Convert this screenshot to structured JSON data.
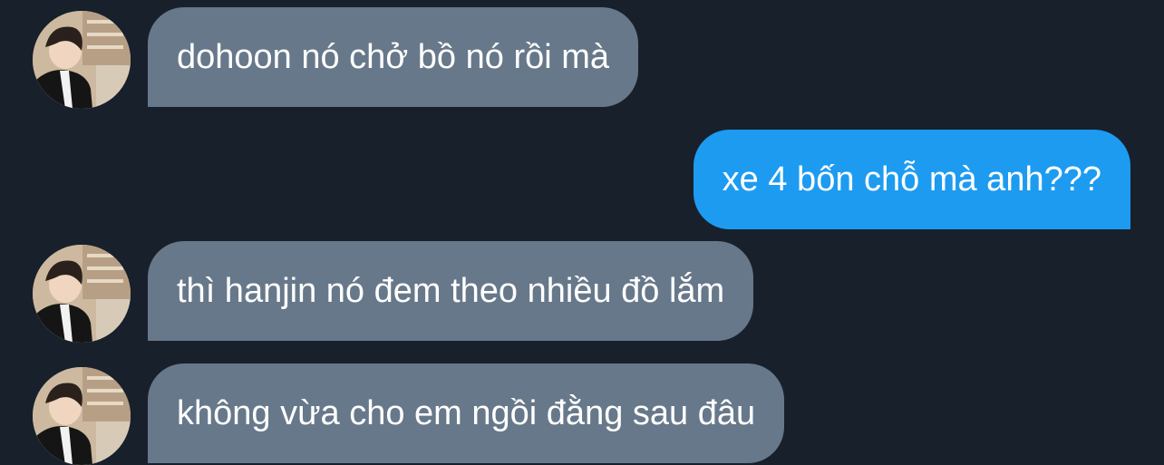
{
  "conversation": {
    "messages": [
      {
        "direction": "incoming",
        "text": "dohoon nó chở bồ nó rồi mà"
      },
      {
        "direction": "outgoing",
        "text": "xe 4 bốn chỗ mà anh???"
      },
      {
        "direction": "incoming",
        "text": "thì hanjin nó đem theo nhiều đồ lắm"
      },
      {
        "direction": "incoming",
        "text": "không vừa cho em ngồi đằng sau đâu"
      }
    ]
  },
  "colors": {
    "background": "#18202b",
    "incoming_bubble": "#67788a",
    "outgoing_bubble": "#1d9bf0",
    "text": "#ffffff"
  },
  "icons": {
    "avatar": "profile-photo"
  }
}
